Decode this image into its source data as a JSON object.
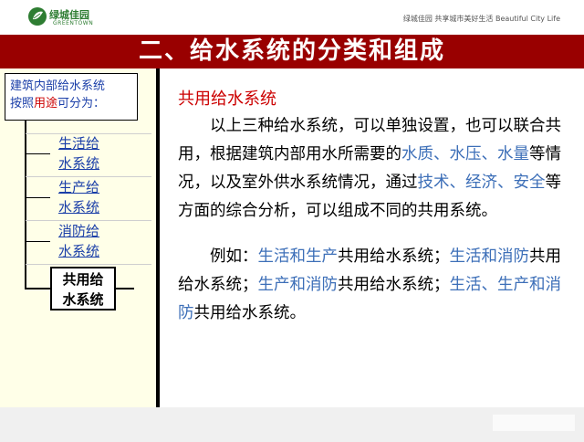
{
  "header": {
    "logo_cn": "绿城佳园",
    "logo_en": "GREENTOWN",
    "tagline": "绿城佳园  共享城市美好生活  Beautiful City Life"
  },
  "title": "二、给水系统的分类和组成",
  "sidebar": {
    "intro_line1": "建筑内部给水系统",
    "intro_line2_pre": "按照",
    "intro_line2_hl": "用途",
    "intro_line2_post": "可分为：",
    "items": [
      {
        "line1": "生活给",
        "line2": "水系统"
      },
      {
        "line1": "生产给",
        "line2": "水系统"
      },
      {
        "line1": "消防给",
        "line2": "水系统"
      },
      {
        "line1": "共用给",
        "line2": "水系统"
      }
    ]
  },
  "content": {
    "subtitle": "共用给水系统",
    "p1": {
      "s1": "以上三种给水系统，可以单独设置，也可以联合共用，根据建筑内部用水所需要的",
      "b1": "水质、水压、水量",
      "s2": "等情况，以及室外供水系统情况，通过",
      "b2": "技术、经济、安全",
      "s3": "等方面的综合分析，可以组成不同的共用系统。"
    },
    "p2": {
      "s1": "例如：",
      "b1": "生活和生产",
      "s2": "共用给水系统；",
      "b2": "生活和消防",
      "s3": "共用给水系统；",
      "b3": "生产和消防",
      "s4": "共用给水系统；",
      "b4": "生活、生产和消防",
      "s5": "共用给水系统。"
    }
  },
  "colors": {
    "title_bar": "#990000",
    "highlight_red": "#cc0000",
    "highlight_blue": "#3d6fb8",
    "link_blue": "#1a3ea8"
  }
}
